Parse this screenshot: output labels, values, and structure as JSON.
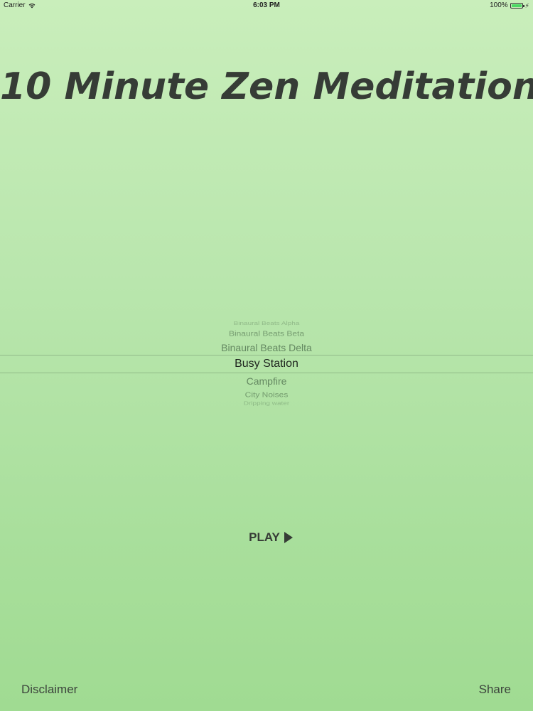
{
  "status_bar": {
    "carrier": "Carrier",
    "time": "6:03 PM",
    "battery": "100%",
    "wifi_icon": "wifi-icon",
    "battery_icon": "battery-icon",
    "charging_icon": "bolt-icon",
    "battery_color": "#4cd964"
  },
  "title": "10 Minute Zen Meditation",
  "picker": {
    "items": [
      "Binaural Beats Alpha",
      "Binaural Beats Beta",
      "Binaural Beats Delta",
      "Busy Station",
      "Campfire",
      "City Noises",
      "Dripping water"
    ],
    "selected": "Busy Station"
  },
  "play": {
    "label": "PLAY",
    "icon": "play-icon"
  },
  "footer": {
    "disclaimer": "Disclaimer",
    "share": "Share"
  },
  "colors": {
    "background_top": "#c9eebb",
    "background_bottom": "#a0db92",
    "text": "#363c36"
  }
}
